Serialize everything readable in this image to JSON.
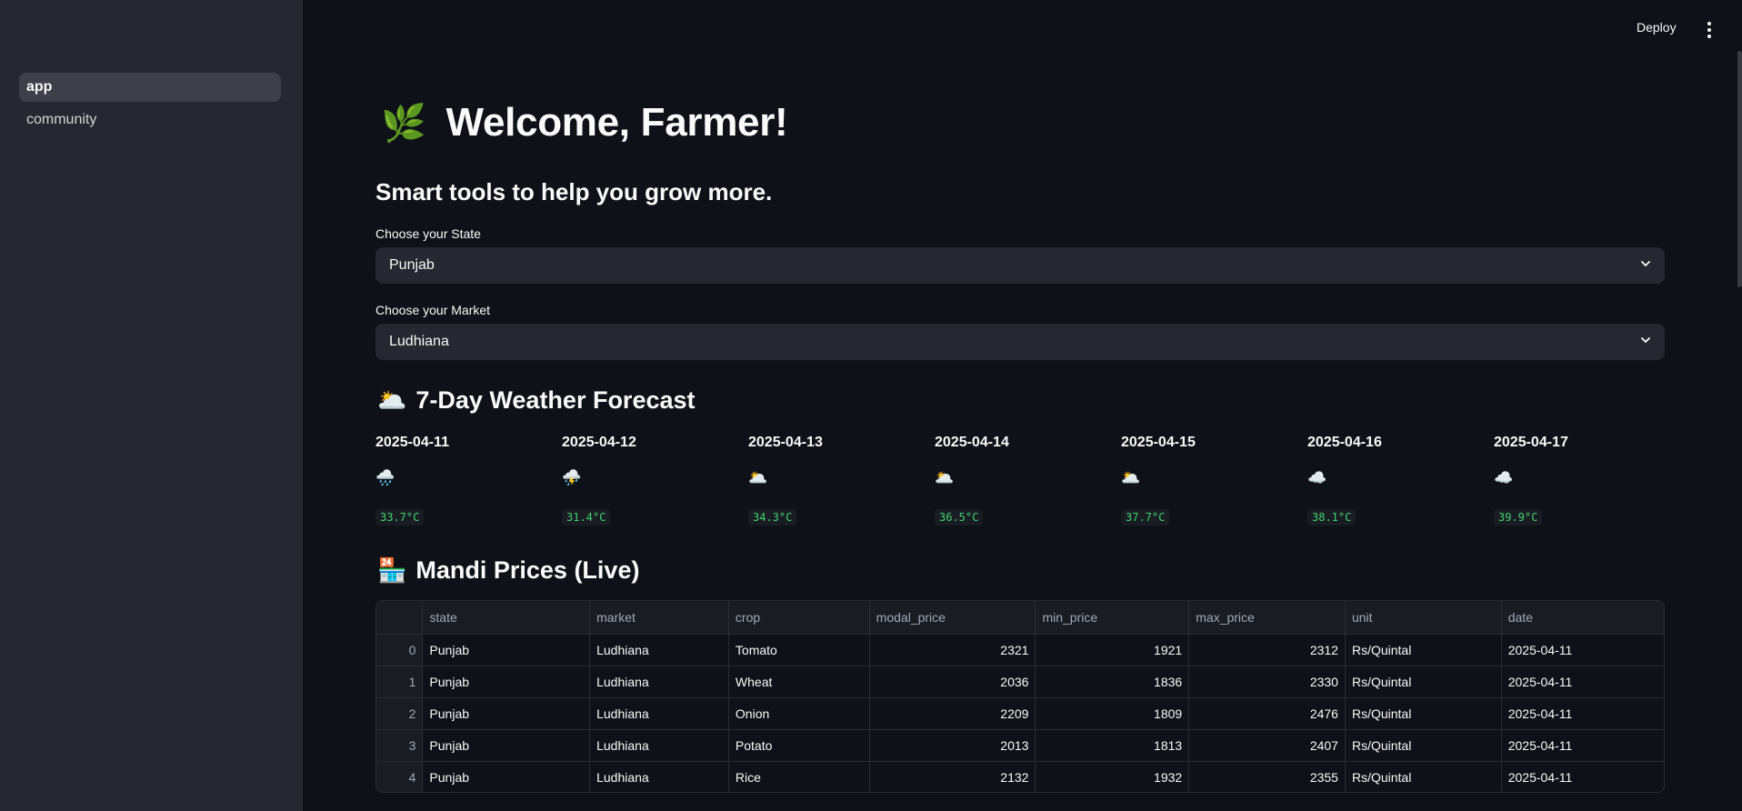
{
  "sidebar": {
    "items": [
      {
        "label": "app",
        "active": true
      },
      {
        "label": "community",
        "active": false
      }
    ]
  },
  "header": {
    "deploy_label": "Deploy",
    "menu_icon": "kebab-menu-icon"
  },
  "hero": {
    "emoji": "🌿",
    "title": "Welcome, Farmer!",
    "subtitle": "Smart tools to help you grow more."
  },
  "state_select": {
    "label": "Choose your State",
    "value": "Punjab"
  },
  "market_select": {
    "label": "Choose your Market",
    "value": "Ludhiana"
  },
  "weather": {
    "emoji": "🌥️",
    "title": "7-Day Weather Forecast",
    "days": [
      {
        "date": "2025-04-11",
        "icon": "🌧️",
        "temp": "33.7°C"
      },
      {
        "date": "2025-04-12",
        "icon": "⛈️",
        "temp": "31.4°C"
      },
      {
        "date": "2025-04-13",
        "icon": "🌥️",
        "temp": "34.3°C"
      },
      {
        "date": "2025-04-14",
        "icon": "🌥️",
        "temp": "36.5°C"
      },
      {
        "date": "2025-04-15",
        "icon": "🌥️",
        "temp": "37.7°C"
      },
      {
        "date": "2025-04-16",
        "icon": "☁️",
        "temp": "38.1°C"
      },
      {
        "date": "2025-04-17",
        "icon": "☁️",
        "temp": "39.9°C"
      }
    ]
  },
  "mandi": {
    "emoji": "🏪",
    "title": "Mandi Prices (Live)",
    "columns": [
      "",
      "state",
      "market",
      "crop",
      "modal_price",
      "min_price",
      "max_price",
      "unit",
      "date"
    ],
    "rows": [
      [
        "0",
        "Punjab",
        "Ludhiana",
        "Tomato",
        "2321",
        "1921",
        "2312",
        "Rs/Quintal",
        "2025-04-11"
      ],
      [
        "1",
        "Punjab",
        "Ludhiana",
        "Wheat",
        "2036",
        "1836",
        "2330",
        "Rs/Quintal",
        "2025-04-11"
      ],
      [
        "2",
        "Punjab",
        "Ludhiana",
        "Onion",
        "2209",
        "1809",
        "2476",
        "Rs/Quintal",
        "2025-04-11"
      ],
      [
        "3",
        "Punjab",
        "Ludhiana",
        "Potato",
        "2013",
        "1813",
        "2407",
        "Rs/Quintal",
        "2025-04-11"
      ],
      [
        "4",
        "Punjab",
        "Ludhiana",
        "Rice",
        "2132",
        "1932",
        "2355",
        "Rs/Quintal",
        "2025-04-11"
      ]
    ]
  }
}
